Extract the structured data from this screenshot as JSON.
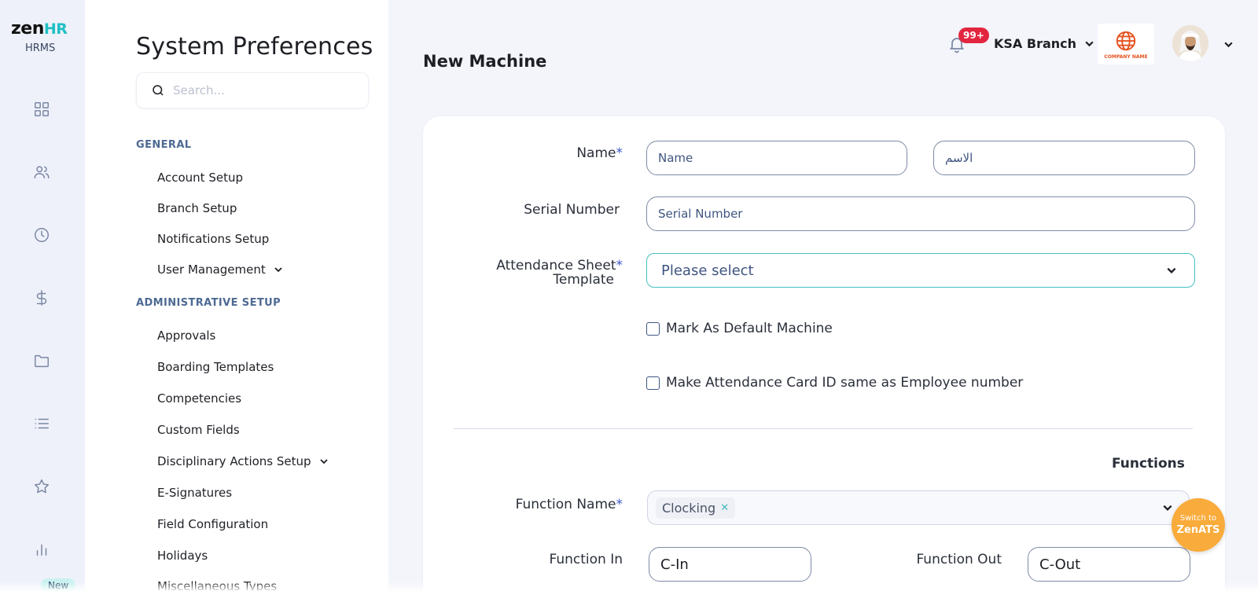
{
  "brand": {
    "logo_main": "zen",
    "logo_accent": "HR",
    "product": "HRMS"
  },
  "rail": {
    "icons": [
      "dashboard-icon",
      "people-icon",
      "clock-icon",
      "dollar-icon",
      "folder-icon",
      "list-icon",
      "star-icon",
      "bar-chart-icon"
    ],
    "new_badge": "New"
  },
  "sidebar": {
    "title": "System Preferences",
    "search_placeholder": "Search...",
    "sections": [
      {
        "heading": "GENERAL",
        "items": [
          "Account Setup",
          "Branch Setup",
          "Notifications Setup",
          "User Management"
        ]
      },
      {
        "heading": "ADMINISTRATIVE SETUP",
        "items": [
          "Approvals",
          "Boarding Templates",
          "Competencies",
          "Custom Fields",
          "Disciplinary Actions Setup",
          "E-Signatures",
          "Field Configuration",
          "Holidays",
          "Miscellaneous Types"
        ]
      }
    ]
  },
  "header": {
    "page_title": "New Machine",
    "notification_count": "99+",
    "branch": "KSA Branch",
    "company_logo_text": "COMPANY NAME"
  },
  "form": {
    "name_label": "Name",
    "name_placeholder_en": "Name",
    "name_placeholder_ar": "الاسم",
    "serial_label": "Serial Number",
    "serial_placeholder": "Serial Number",
    "template_label_1": "Attendance Sheet",
    "template_label_2": "Template",
    "template_placeholder": "Please select",
    "default_machine_label": "Mark As Default Machine",
    "card_id_label": "Make Attendance Card ID same as Employee number",
    "functions_title": "Functions",
    "function_name_label": "Function Name",
    "function_name_tag": "Clocking",
    "function_in_label": "Function In",
    "function_in_value": "C-In",
    "function_out_label": "Function Out",
    "function_out_value": "C-Out",
    "required_mark": "*"
  },
  "switch_fab": {
    "line1": "Switch to",
    "line2": "ZenATS"
  },
  "colors": {
    "accent": "#1fbfc4",
    "badge": "#e3263f",
    "fab": "#f9ab3b",
    "section": "#4d6a93"
  }
}
